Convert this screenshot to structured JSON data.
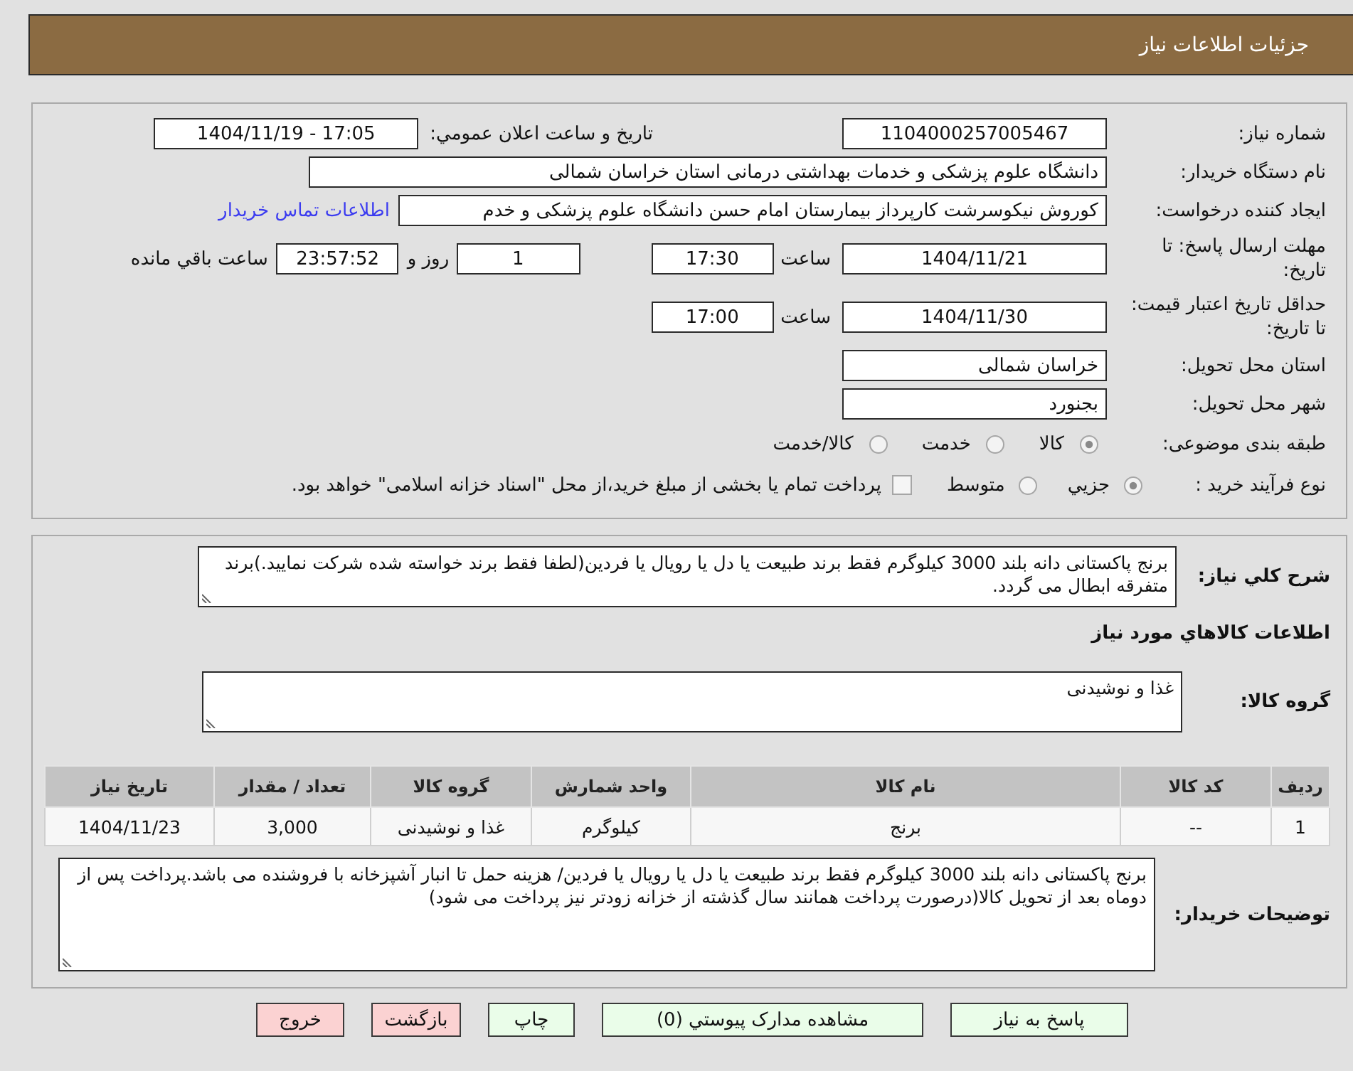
{
  "header": {
    "title": "جزئیات اطلاعات نیاز"
  },
  "need_info": {
    "need_number": {
      "label": "شماره نیاز:",
      "value": "1104000257005467"
    },
    "announce_datetime": {
      "label": "تاریخ و ساعت اعلان عمومي:",
      "value": "1404/11/19 - 17:05"
    },
    "buyer_org": {
      "label": "نام دستگاه خریدار:",
      "value": "دانشگاه علوم پزشکی و خدمات بهداشتی درمانی استان خراسان شمالی"
    },
    "requester": {
      "label": "ایجاد کننده درخواست:",
      "value": "کوروش نیکوسرشت کارپرداز بیمارستان امام حسن دانشگاه علوم پزشکی و خدم",
      "contact_link": "اطلاعات تماس خریدار"
    },
    "response_deadline": {
      "label": "مهلت ارسال پاسخ: تا تاریخ:",
      "date": "1404/11/21",
      "time_label": "ساعت",
      "time": "17:30",
      "days": "1",
      "days_label": "روز و",
      "remaining": "23:57:52",
      "remaining_label": "ساعت باقي مانده"
    },
    "price_validity": {
      "label": "حداقل تاریخ اعتبار قیمت: تا تاریخ:",
      "date": "1404/11/30",
      "time_label": "ساعت",
      "time": "17:00"
    },
    "delivery_province": {
      "label": "استان محل تحویل:",
      "value": "خراسان شمالی"
    },
    "delivery_city": {
      "label": "شهر محل تحویل:",
      "value": "بجنورد"
    },
    "category": {
      "label": "طبقه بندی موضوعی:",
      "options": [
        {
          "label": "کالا",
          "selected": true
        },
        {
          "label": "خدمت",
          "selected": false
        },
        {
          "label": "کالا/خدمت",
          "selected": false
        }
      ]
    },
    "purchase_process": {
      "label": "نوع فرآیند خرید :",
      "options": [
        {
          "label": "جزيي",
          "selected": true
        },
        {
          "label": "متوسط",
          "selected": false
        }
      ],
      "treasury_payment": {
        "checked": false,
        "text": "پرداخت تمام یا بخشی از مبلغ خرید،از محل \"اسناد خزانه اسلامی\" خواهد بود."
      }
    }
  },
  "requirements": {
    "summary": {
      "label": "شرح كلي نياز:",
      "value": "برنج پاکستانی دانه بلند 3000 کیلوگرم فقط برند طبیعت یا دل یا رویال یا فردین(لطفا فقط برند خواسته شده شرکت نمایید.)برند متفرقه ابطال می گردد."
    },
    "goods_heading": "اطلاعات كالاهاي مورد نياز",
    "goods_group": {
      "label": "گروه کالا:",
      "value": "غذا و نوشیدنی"
    },
    "table": {
      "columns": [
        "ردیف",
        "کد کالا",
        "نام کالا",
        "واحد شمارش",
        "گروه کالا",
        "تعداد / مقدار",
        "تاریخ نیاز"
      ],
      "rows": [
        [
          "1",
          "--",
          "برنج",
          "کیلوگرم",
          "غذا و نوشیدنی",
          "3,000",
          "1404/11/23"
        ]
      ]
    },
    "buyer_notes": {
      "label": "توضیحات خریدار:",
      "value": "برنج پاکستانی دانه بلند 3000 کیلوگرم فقط برند طبیعت یا دل یا رویال یا فردین/ هزینه حمل تا انبار آشپزخانه با فروشنده می باشد.پرداخت پس از دوماه بعد از تحویل کالا(درصورت پرداخت همانند سال گذشته از خزانه زودتر نیز پرداخت می شود)"
    }
  },
  "buttons": [
    {
      "label": "پاسخ به نیاز",
      "kind": "reply"
    },
    {
      "label": "مشاهده مدارک پیوستي (0)",
      "kind": "attachments"
    },
    {
      "label": "چاپ",
      "kind": "print"
    },
    {
      "label": "بازگشت",
      "kind": "back"
    },
    {
      "label": "خروج",
      "kind": "exit"
    }
  ]
}
